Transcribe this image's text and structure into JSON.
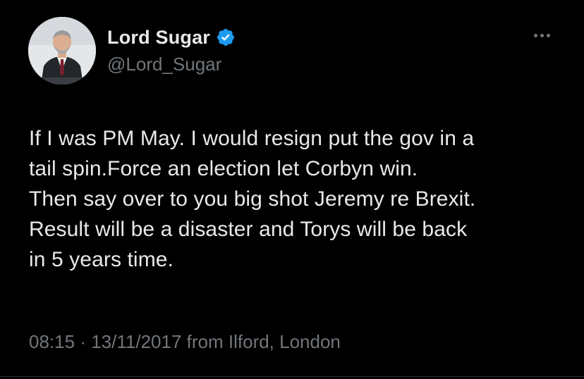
{
  "author": {
    "display_name": "Lord Sugar",
    "handle": "@Lord_Sugar",
    "verified": true,
    "verified_icon": "verified-badge-icon",
    "verified_color": "#1d9bf0"
  },
  "tweet": {
    "text": "If I was PM May. I would resign put the gov in a\ntail spin.Force an election let Corbyn win.\nThen say over to you big shot Jeremy re Brexit.\nResult will be a disaster and Torys will be back\nin 5 years time.",
    "time": "08:15",
    "separator": "·",
    "date": "13/11/2017",
    "source": "from Ilford, London"
  },
  "menu": {
    "icon": "more-options-icon"
  },
  "colors": {
    "background": "#000000",
    "primary_text": "#e7e9ea",
    "secondary_text": "#71767b"
  }
}
